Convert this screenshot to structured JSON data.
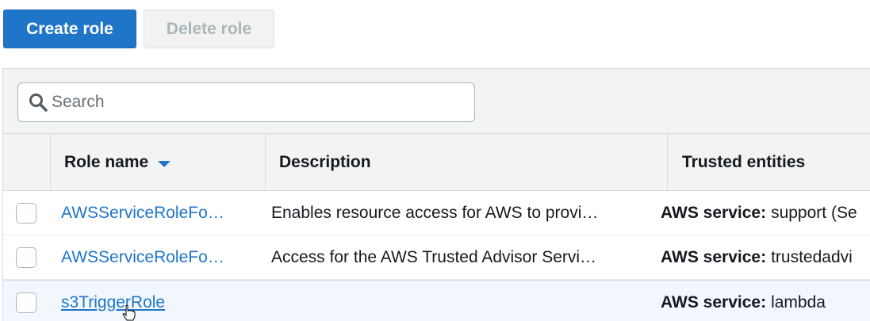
{
  "toolbar": {
    "create_label": "Create role",
    "delete_label": "Delete role"
  },
  "search": {
    "placeholder": "Search",
    "value": ""
  },
  "table": {
    "columns": {
      "name": "Role name",
      "description": "Description",
      "trusted": "Trusted entities"
    },
    "rows": [
      {
        "name": "AWSServiceRoleFo…",
        "description": "Enables resource access for AWS to provi…",
        "trusted_label": "AWS service:",
        "trusted_value": "support (Se"
      },
      {
        "name": "AWSServiceRoleFo…",
        "description": "Access for the AWS Trusted Advisor Servi…",
        "trusted_label": "AWS service:",
        "trusted_value": "trustedadvi"
      },
      {
        "name": "s3TriggerRole",
        "description": "",
        "trusted_label": "AWS service:",
        "trusted_value": "lambda"
      }
    ]
  },
  "colors": {
    "primary": "#1f76c9",
    "link": "#1f76c9",
    "header_bg": "#f2f3f3",
    "hover_row_bg": "#f1f7fc"
  }
}
